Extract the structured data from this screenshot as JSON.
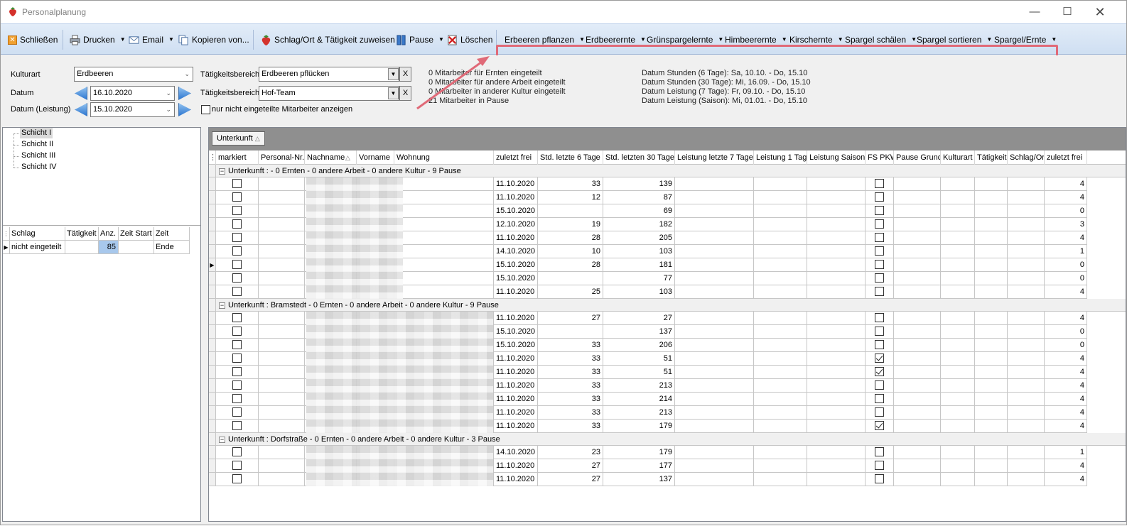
{
  "window": {
    "title": "Personalplanung"
  },
  "toolbar": {
    "close": "Schließen",
    "print": "Drucken",
    "email": "Email",
    "copy": "Kopieren von...",
    "assign": "Schlag/Ort & Tätigkeit zuweisen",
    "pause": "Pause",
    "delete": "Löschen",
    "activity_menus": [
      "Erbeeren pflanzen",
      "Erdbeerernte",
      "Grünspargelernte",
      "Himbeerernte",
      "Kirschernte",
      "Spargel schälen",
      "Spargel sortieren",
      "Spargel/Ernte"
    ],
    "highlight_color": "#e06a78"
  },
  "filters": {
    "kulturart_label": "Kulturart",
    "kulturart_value": "Erdbeeren",
    "datum_label": "Datum",
    "datum_value": "16.10.2020",
    "datum_leistung_label": "Datum (Leistung)",
    "datum_leistung_value": "15.10.2020",
    "tb1_label": "Tätigkeitsbereich I",
    "tb1_value": "Erdbeeren pflücken",
    "tb2_label": "Tätigkeitsbereich II",
    "tb2_value": "Hof-Team",
    "only_unassigned": "nur nicht eingeteilte Mitarbeiter anzeigen",
    "clear_btn": "X"
  },
  "summary": [
    "0 Mitarbeiter für Ernten eingeteilt",
    "0 Mitarbeiter für andere Arbeit eingeteilt",
    "0 Mitarbeiter in anderer Kultur eingeteilt",
    "21 Mitarbeiter in Pause"
  ],
  "dates_info": [
    "Datum Stunden (6 Tage): Sa, 10.10. - Do, 15.10",
    "Datum Stunden (30 Tage): Mi, 16.09. - Do, 15.10",
    "Datum Leistung (7 Tage): Fr, 09.10. - Do, 15.10",
    "Datum Leistung (Saison): Mi, 01.01. - Do, 15.10"
  ],
  "shifts": [
    "Schicht I",
    "Schicht II",
    "Schicht III",
    "Schicht IV"
  ],
  "schlag_table": {
    "headers": [
      "Schlag",
      "Tätigkeit",
      "Anz.",
      "Zeit Start",
      "Zeit Ende"
    ],
    "row": {
      "schlag": "nicht eingeteilt",
      "taetigkeit": "",
      "anz": "85",
      "start": "",
      "ende": ""
    }
  },
  "grid": {
    "group_chip": "Unterkunft",
    "headers": [
      "markiert",
      "Personal-Nr.",
      "Nachname",
      "Vorname",
      "Wohnung",
      "zuletzt frei",
      "Std. letzte 6 Tage",
      "Std. letzten 30 Tage",
      "Leistung letzte 7 Tage",
      "Leistung 1 Tag",
      "Leistung Saison",
      "FS PKW",
      "Pause Grund",
      "Kulturart",
      "Tätigkeit",
      "Schlag/Ort",
      "zuletzt frei"
    ],
    "groups": [
      {
        "title": "Unterkunft :  - 0 Ernten - 0 andere Arbeit - 0 andere Kultur - 9 Pause",
        "rows": [
          {
            "frei": "11.10.2020",
            "std6": "33",
            "std30": "139",
            "fs": false,
            "last": "4"
          },
          {
            "frei": "11.10.2020",
            "std6": "12",
            "std30": "87",
            "fs": false,
            "last": "4"
          },
          {
            "frei": "15.10.2020",
            "std6": "",
            "std30": "69",
            "fs": false,
            "last": "0"
          },
          {
            "frei": "12.10.2020",
            "std6": "19",
            "std30": "182",
            "fs": false,
            "last": "3"
          },
          {
            "frei": "11.10.2020",
            "std6": "28",
            "std30": "205",
            "fs": false,
            "last": "4"
          },
          {
            "frei": "14.10.2020",
            "std6": "10",
            "std30": "103",
            "fs": false,
            "last": "1"
          },
          {
            "frei": "15.10.2020",
            "std6": "28",
            "std30": "181",
            "fs": false,
            "last": "0"
          },
          {
            "frei": "15.10.2020",
            "std6": "",
            "std30": "77",
            "fs": false,
            "last": "0"
          },
          {
            "frei": "11.10.2020",
            "std6": "25",
            "std30": "103",
            "fs": false,
            "last": "4"
          }
        ]
      },
      {
        "title": "Unterkunft : Bramstedt - 0 Ernten - 0 andere Arbeit - 0 andere Kultur - 9 Pause",
        "rows": [
          {
            "frei": "11.10.2020",
            "std6": "27",
            "std30": "27",
            "fs": false,
            "last": "4"
          },
          {
            "frei": "15.10.2020",
            "std6": "",
            "std30": "137",
            "fs": false,
            "last": "0"
          },
          {
            "frei": "15.10.2020",
            "std6": "33",
            "std30": "206",
            "fs": false,
            "last": "0"
          },
          {
            "frei": "11.10.2020",
            "std6": "33",
            "std30": "51",
            "fs": true,
            "last": "4"
          },
          {
            "frei": "11.10.2020",
            "std6": "33",
            "std30": "51",
            "fs": true,
            "last": "4"
          },
          {
            "frei": "11.10.2020",
            "std6": "33",
            "std30": "213",
            "fs": false,
            "last": "4"
          },
          {
            "frei": "11.10.2020",
            "std6": "33",
            "std30": "214",
            "fs": false,
            "last": "4"
          },
          {
            "frei": "11.10.2020",
            "std6": "33",
            "std30": "213",
            "fs": false,
            "last": "4"
          },
          {
            "frei": "11.10.2020",
            "std6": "33",
            "std30": "179",
            "fs": true,
            "last": "4"
          }
        ]
      },
      {
        "title": "Unterkunft : Dorfstraße - 0 Ernten - 0 andere Arbeit - 0 andere Kultur - 3 Pause",
        "rows": [
          {
            "frei": "14.10.2020",
            "std6": "23",
            "std30": "179",
            "fs": false,
            "last": "1"
          },
          {
            "frei": "11.10.2020",
            "std6": "27",
            "std30": "177",
            "fs": false,
            "last": "4"
          },
          {
            "frei": "11.10.2020",
            "std6": "27",
            "std30": "137",
            "fs": false,
            "last": "4"
          }
        ]
      }
    ]
  }
}
